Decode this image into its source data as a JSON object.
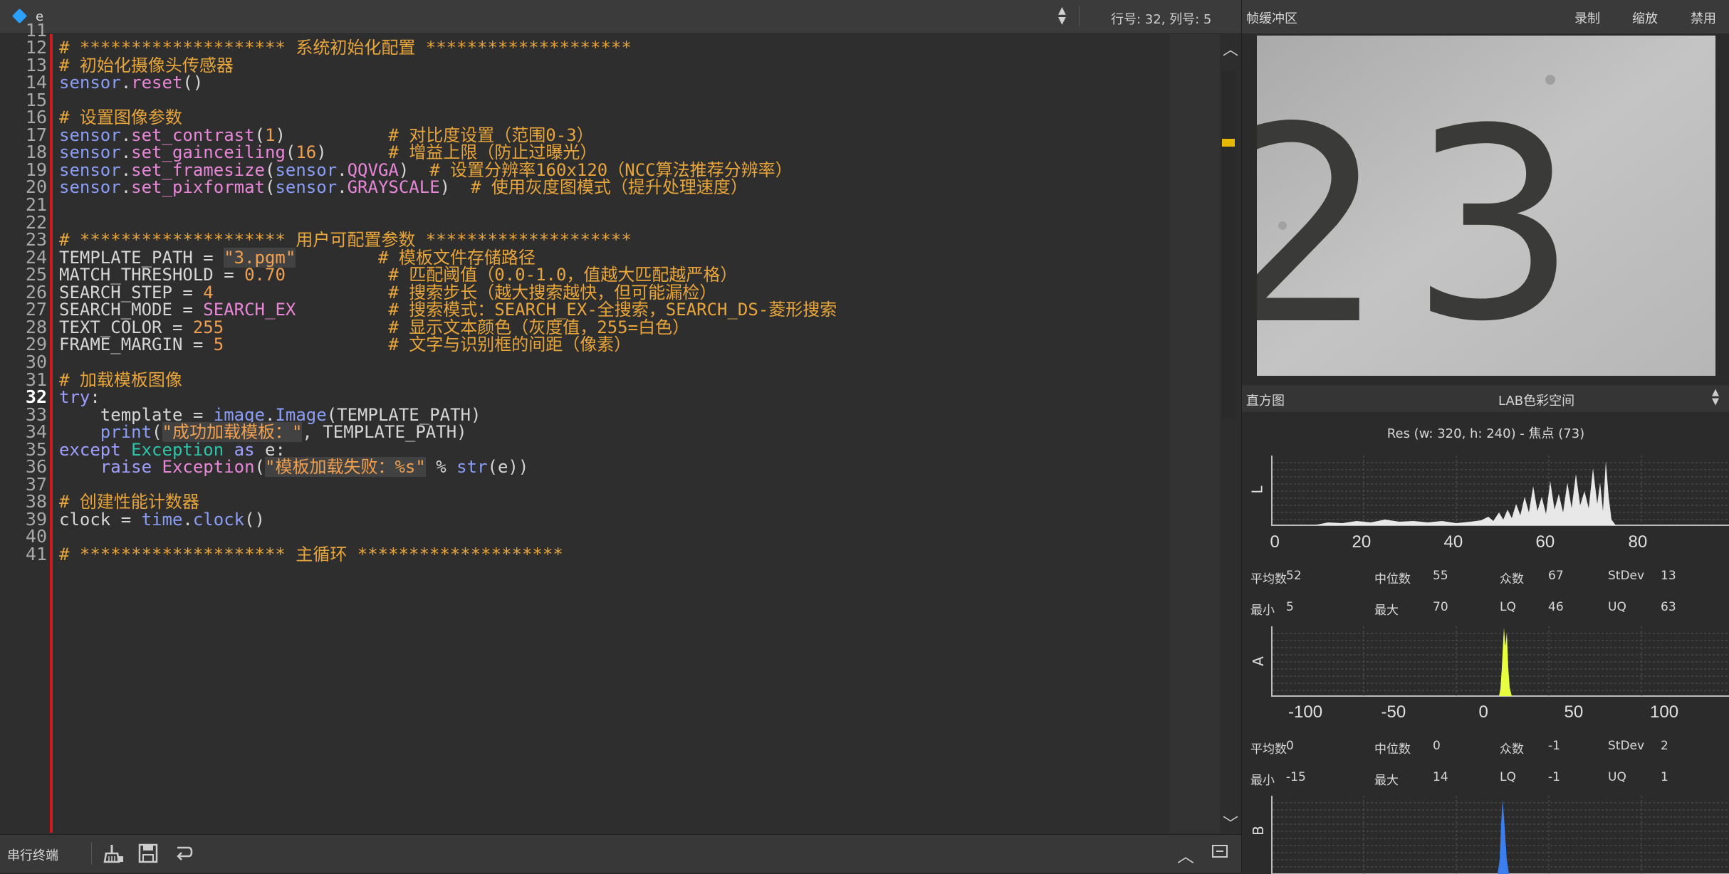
{
  "editor": {
    "tab_name": "e",
    "cursor_position": "行号: 32, 列号: 5",
    "current_line": 32,
    "lines": [
      {
        "n": "11",
        "segs": []
      },
      {
        "n": "12",
        "segs": [
          {
            "t": "# ******************** 系统初始化配置 ********************",
            "c": "c"
          }
        ]
      },
      {
        "n": "13",
        "segs": [
          {
            "t": "# 初始化摄像头传感器",
            "c": "c"
          }
        ]
      },
      {
        "n": "14",
        "segs": [
          {
            "t": "sensor",
            "c": "b"
          },
          {
            "t": "."
          },
          {
            "t": "reset",
            "c": "f"
          },
          {
            "t": "()"
          }
        ]
      },
      {
        "n": "15",
        "segs": []
      },
      {
        "n": "16",
        "segs": [
          {
            "t": "# 设置图像参数",
            "c": "c"
          }
        ]
      },
      {
        "n": "17",
        "segs": [
          {
            "t": "sensor",
            "c": "b"
          },
          {
            "t": "."
          },
          {
            "t": "set_contrast",
            "c": "f"
          },
          {
            "t": "("
          },
          {
            "t": "1",
            "c": "n"
          },
          {
            "t": ")          "
          },
          {
            "t": "# 对比度设置（范围0-3）",
            "c": "c"
          }
        ]
      },
      {
        "n": "18",
        "segs": [
          {
            "t": "sensor",
            "c": "b"
          },
          {
            "t": "."
          },
          {
            "t": "set_gainceiling",
            "c": "f"
          },
          {
            "t": "("
          },
          {
            "t": "16",
            "c": "n"
          },
          {
            "t": ")      "
          },
          {
            "t": "# 增益上限（防止过曝光）",
            "c": "c"
          }
        ]
      },
      {
        "n": "19",
        "segs": [
          {
            "t": "sensor",
            "c": "b"
          },
          {
            "t": "."
          },
          {
            "t": "set_framesize",
            "c": "f"
          },
          {
            "t": "("
          },
          {
            "t": "sensor",
            "c": "b"
          },
          {
            "t": "."
          },
          {
            "t": "QQVGA",
            "c": "f"
          },
          {
            "t": ")  "
          },
          {
            "t": "# 设置分辨率160x120（NCC算法推荐分辨率）",
            "c": "c"
          }
        ]
      },
      {
        "n": "20",
        "segs": [
          {
            "t": "sensor",
            "c": "b"
          },
          {
            "t": "."
          },
          {
            "t": "set_pixformat",
            "c": "f"
          },
          {
            "t": "("
          },
          {
            "t": "sensor",
            "c": "b"
          },
          {
            "t": "."
          },
          {
            "t": "GRAYSCALE",
            "c": "f"
          },
          {
            "t": ")  "
          },
          {
            "t": "# 使用灰度图模式（提升处理速度）",
            "c": "c"
          }
        ]
      },
      {
        "n": "21",
        "segs": []
      },
      {
        "n": "22",
        "segs": []
      },
      {
        "n": "23",
        "segs": [
          {
            "t": "# ******************** 用户可配置参数 ********************",
            "c": "c"
          }
        ]
      },
      {
        "n": "24",
        "segs": [
          {
            "t": "TEMPLATE_PATH = "
          },
          {
            "t": "\"3.pgm\"",
            "c": "s"
          },
          {
            "t": "        "
          },
          {
            "t": "# 模板文件存储路径",
            "c": "c"
          }
        ]
      },
      {
        "n": "25",
        "segs": [
          {
            "t": "MATCH_THRESHOLD = "
          },
          {
            "t": "0.70",
            "c": "n"
          },
          {
            "t": "          "
          },
          {
            "t": "# 匹配阈值（0.0-1.0，值越大匹配越严格）",
            "c": "c"
          }
        ]
      },
      {
        "n": "26",
        "segs": [
          {
            "t": "SEARCH_STEP = "
          },
          {
            "t": "4",
            "c": "n"
          },
          {
            "t": "                 "
          },
          {
            "t": "# 搜索步长（越大搜索越快，但可能漏检）",
            "c": "c"
          }
        ]
      },
      {
        "n": "27",
        "segs": [
          {
            "t": "SEARCH_MODE = "
          },
          {
            "t": "SEARCH_EX",
            "c": "f"
          },
          {
            "t": "         "
          },
          {
            "t": "# 搜索模式：SEARCH_EX-全搜索，SEARCH_DS-菱形搜索",
            "c": "c"
          }
        ]
      },
      {
        "n": "28",
        "segs": [
          {
            "t": "TEXT_COLOR = "
          },
          {
            "t": "255",
            "c": "n"
          },
          {
            "t": "                "
          },
          {
            "t": "# 显示文本颜色（灰度值，255=白色）",
            "c": "c"
          }
        ]
      },
      {
        "n": "29",
        "segs": [
          {
            "t": "FRAME_MARGIN = "
          },
          {
            "t": "5",
            "c": "n"
          },
          {
            "t": "                "
          },
          {
            "t": "# 文字与识别框的间距（像素）",
            "c": "c"
          }
        ]
      },
      {
        "n": "30",
        "segs": []
      },
      {
        "n": "31",
        "segs": [
          {
            "t": "# 加载模板图像",
            "c": "c"
          }
        ]
      },
      {
        "n": "32",
        "segs": [
          {
            "t": "try",
            "c": "k"
          },
          {
            "t": ":"
          }
        ]
      },
      {
        "n": "33",
        "segs": [
          {
            "t": "    template = "
          },
          {
            "t": "image",
            "c": "b"
          },
          {
            "t": "."
          },
          {
            "t": "Image",
            "c": "b"
          },
          {
            "t": "(TEMPLATE_PATH)"
          }
        ]
      },
      {
        "n": "34",
        "segs": [
          {
            "t": "    "
          },
          {
            "t": "print",
            "c": "b"
          },
          {
            "t": "("
          },
          {
            "t": "\"成功加载模板：\"",
            "c": "s"
          },
          {
            "t": ", TEMPLATE_PATH)"
          }
        ]
      },
      {
        "n": "35",
        "segs": [
          {
            "t": "except",
            "c": "k"
          },
          {
            "t": " "
          },
          {
            "t": "Exception",
            "c": "e"
          },
          {
            "t": " "
          },
          {
            "t": "as",
            "c": "k"
          },
          {
            "t": " e:"
          }
        ]
      },
      {
        "n": "36",
        "segs": [
          {
            "t": "    "
          },
          {
            "t": "raise",
            "c": "k"
          },
          {
            "t": " "
          },
          {
            "t": "Exception",
            "c": "f"
          },
          {
            "t": "("
          },
          {
            "t": "\"模板加载失败：%s\"",
            "c": "s"
          },
          {
            "t": " % "
          },
          {
            "t": "str",
            "c": "b"
          },
          {
            "t": "(e))"
          }
        ]
      },
      {
        "n": "37",
        "segs": []
      },
      {
        "n": "38",
        "segs": [
          {
            "t": "# 创建性能计数器",
            "c": "c"
          }
        ]
      },
      {
        "n": "39",
        "segs": [
          {
            "t": "clock = "
          },
          {
            "t": "time",
            "c": "b"
          },
          {
            "t": "."
          },
          {
            "t": "clock",
            "c": "b"
          },
          {
            "t": "()"
          }
        ]
      },
      {
        "n": "40",
        "segs": []
      },
      {
        "n": "41",
        "segs": [
          {
            "t": "# ******************** 主循环 ********************",
            "c": "c"
          }
        ]
      }
    ]
  },
  "bottombar": {
    "serial_terminal_label": "串行终端"
  },
  "framebuffer": {
    "title": "帧缓冲区",
    "record_label": "录制",
    "zoom_label": "缩放",
    "disable_label": "禁用",
    "digits_visible": "2 3"
  },
  "histogram": {
    "title": "直方图",
    "color_space": "LAB色彩空间",
    "resolution_info": "Res  (w: 320,  h: 240) - 焦点 (73)",
    "channels": [
      {
        "label": "L",
        "color": "#e8e8e8",
        "ticks": [
          "0",
          "20",
          "40",
          "60",
          "80"
        ],
        "stats": [
          [
            "平均数",
            "52",
            "中位数",
            "55",
            "众数",
            "67",
            "StDev",
            "13"
          ],
          [
            "最小",
            "5",
            "最大",
            "70",
            "LQ",
            "46",
            "UQ",
            "63"
          ]
        ]
      },
      {
        "label": "A",
        "color": "#e8ff40",
        "ticks": [
          "-100",
          "-50",
          "0",
          "50",
          "100"
        ],
        "stats": [
          [
            "平均数",
            "0",
            "中位数",
            "0",
            "众数",
            "-1",
            "StDev",
            "2"
          ],
          [
            "最小",
            "-15",
            "最大",
            "14",
            "LQ",
            "-1",
            "UQ",
            "1"
          ]
        ]
      },
      {
        "label": "B",
        "color": "#3a7ef0",
        "ticks": [],
        "stats": []
      }
    ]
  }
}
